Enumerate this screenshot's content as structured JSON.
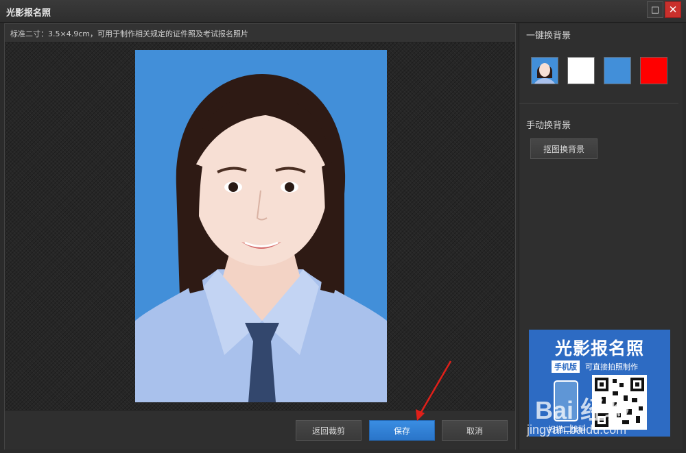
{
  "window": {
    "title": "光影报名照",
    "max_icon": "maximize-icon",
    "close_icon": "close-icon"
  },
  "main": {
    "info_text": "标准二寸：3.5×4.9cm，可用于制作相关规定的证件照及考试报名照片",
    "photo_background": "#428fd9"
  },
  "buttons": {
    "back": "返回裁剪",
    "save": "保存",
    "cancel": "取消"
  },
  "side": {
    "one_click_label": "一键换背景",
    "swatches": [
      {
        "name": "original-photo",
        "color": "#428fd9"
      },
      {
        "name": "white",
        "color": "#ffffff"
      },
      {
        "name": "blue",
        "color": "#428fd9"
      },
      {
        "name": "red",
        "color": "#ff0000"
      }
    ],
    "manual_label": "手动换背景",
    "cutout_button": "抠图换背景"
  },
  "ad": {
    "title": "光影报名照",
    "badge": "手机版",
    "subtitle": "可直接拍照制作",
    "caption": "扫描二维码"
  },
  "watermark": {
    "main": "Bai 经验",
    "sub": "jingyan.baidu.com"
  },
  "colors": {
    "accent": "#2a75c9",
    "close": "#c9302c",
    "annotation_arrow": "#e0201a"
  }
}
